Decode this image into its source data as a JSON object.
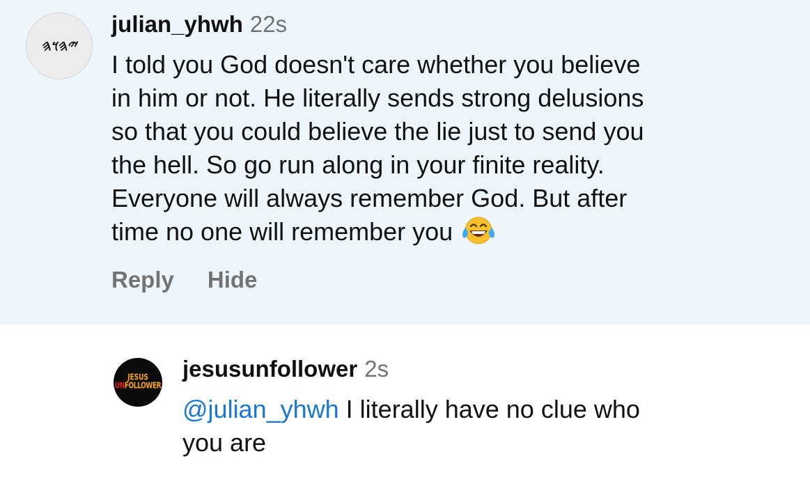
{
  "comment": {
    "avatar_text": "𐤉𐤄𐤅𐤄",
    "username": "julian_yhwh",
    "time": "22s",
    "lines": [
      "I told you God doesn't care whether you believe",
      "in him or not. He literally sends strong delusions",
      "so that you could believe the lie just to send you",
      "the hell. So go run along in your finite reality.",
      "Everyone will always remember God. But after",
      "time no one will remember you"
    ],
    "emoji": "face-with-tears-of-joy",
    "reply_label": "Reply",
    "hide_label": "Hide"
  },
  "reply": {
    "avatar_line1": "JESUS",
    "avatar_line2_a": "UN",
    "avatar_line2_b": "FOLLOWER",
    "username": "jesusunfollower",
    "time": "2s",
    "mention": "@julian_yhwh",
    "line1_rest": " I literally have no clue who",
    "line2": "you are"
  },
  "colors": {
    "comment_bg": "#eff6fb",
    "mention": "#1877d4",
    "muted": "#737373"
  }
}
